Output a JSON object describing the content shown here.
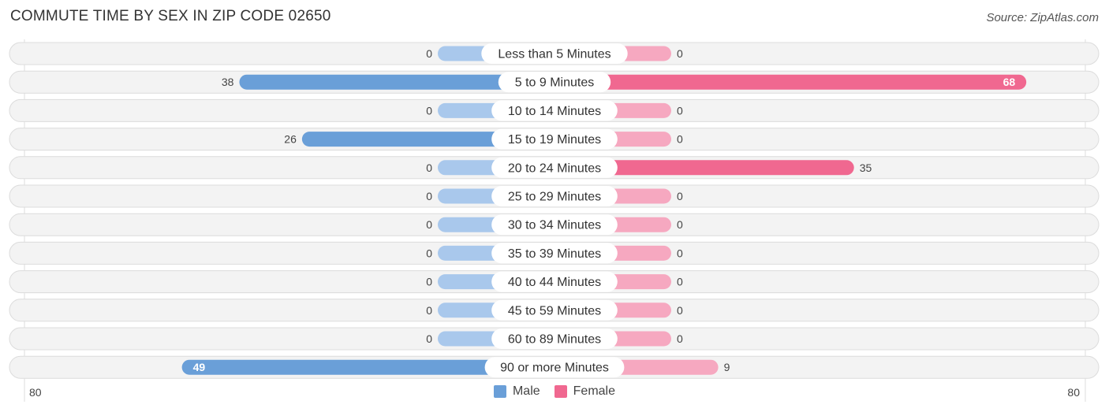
{
  "title": "COMMUTE TIME BY SEX IN ZIP CODE 02650",
  "source": "Source: ZipAtlas.com",
  "colors": {
    "male": "#6a9fd8",
    "male_light": "#a9c8ec",
    "female": "#f06890",
    "female_light": "#f6a8c0"
  },
  "chart_data": {
    "type": "bar",
    "orientation": "horizontal-diverging",
    "title": "COMMUTE TIME BY SEX IN ZIP CODE 02650",
    "categories": [
      "Less than 5 Minutes",
      "5 to 9 Minutes",
      "10 to 14 Minutes",
      "15 to 19 Minutes",
      "20 to 24 Minutes",
      "25 to 29 Minutes",
      "30 to 34 Minutes",
      "35 to 39 Minutes",
      "40 to 44 Minutes",
      "45 to 59 Minutes",
      "60 to 89 Minutes",
      "90 or more Minutes"
    ],
    "series": [
      {
        "name": "Male",
        "values": [
          0,
          38,
          0,
          26,
          0,
          0,
          0,
          0,
          0,
          0,
          0,
          49
        ]
      },
      {
        "name": "Female",
        "values": [
          0,
          68,
          0,
          0,
          35,
          0,
          0,
          0,
          0,
          0,
          0,
          9
        ]
      }
    ],
    "xlim": [
      80,
      80
    ],
    "axis_labels": {
      "left": "80",
      "right": "80"
    },
    "legend": {
      "position": "bottom-center",
      "entries": [
        "Male",
        "Female"
      ]
    }
  }
}
